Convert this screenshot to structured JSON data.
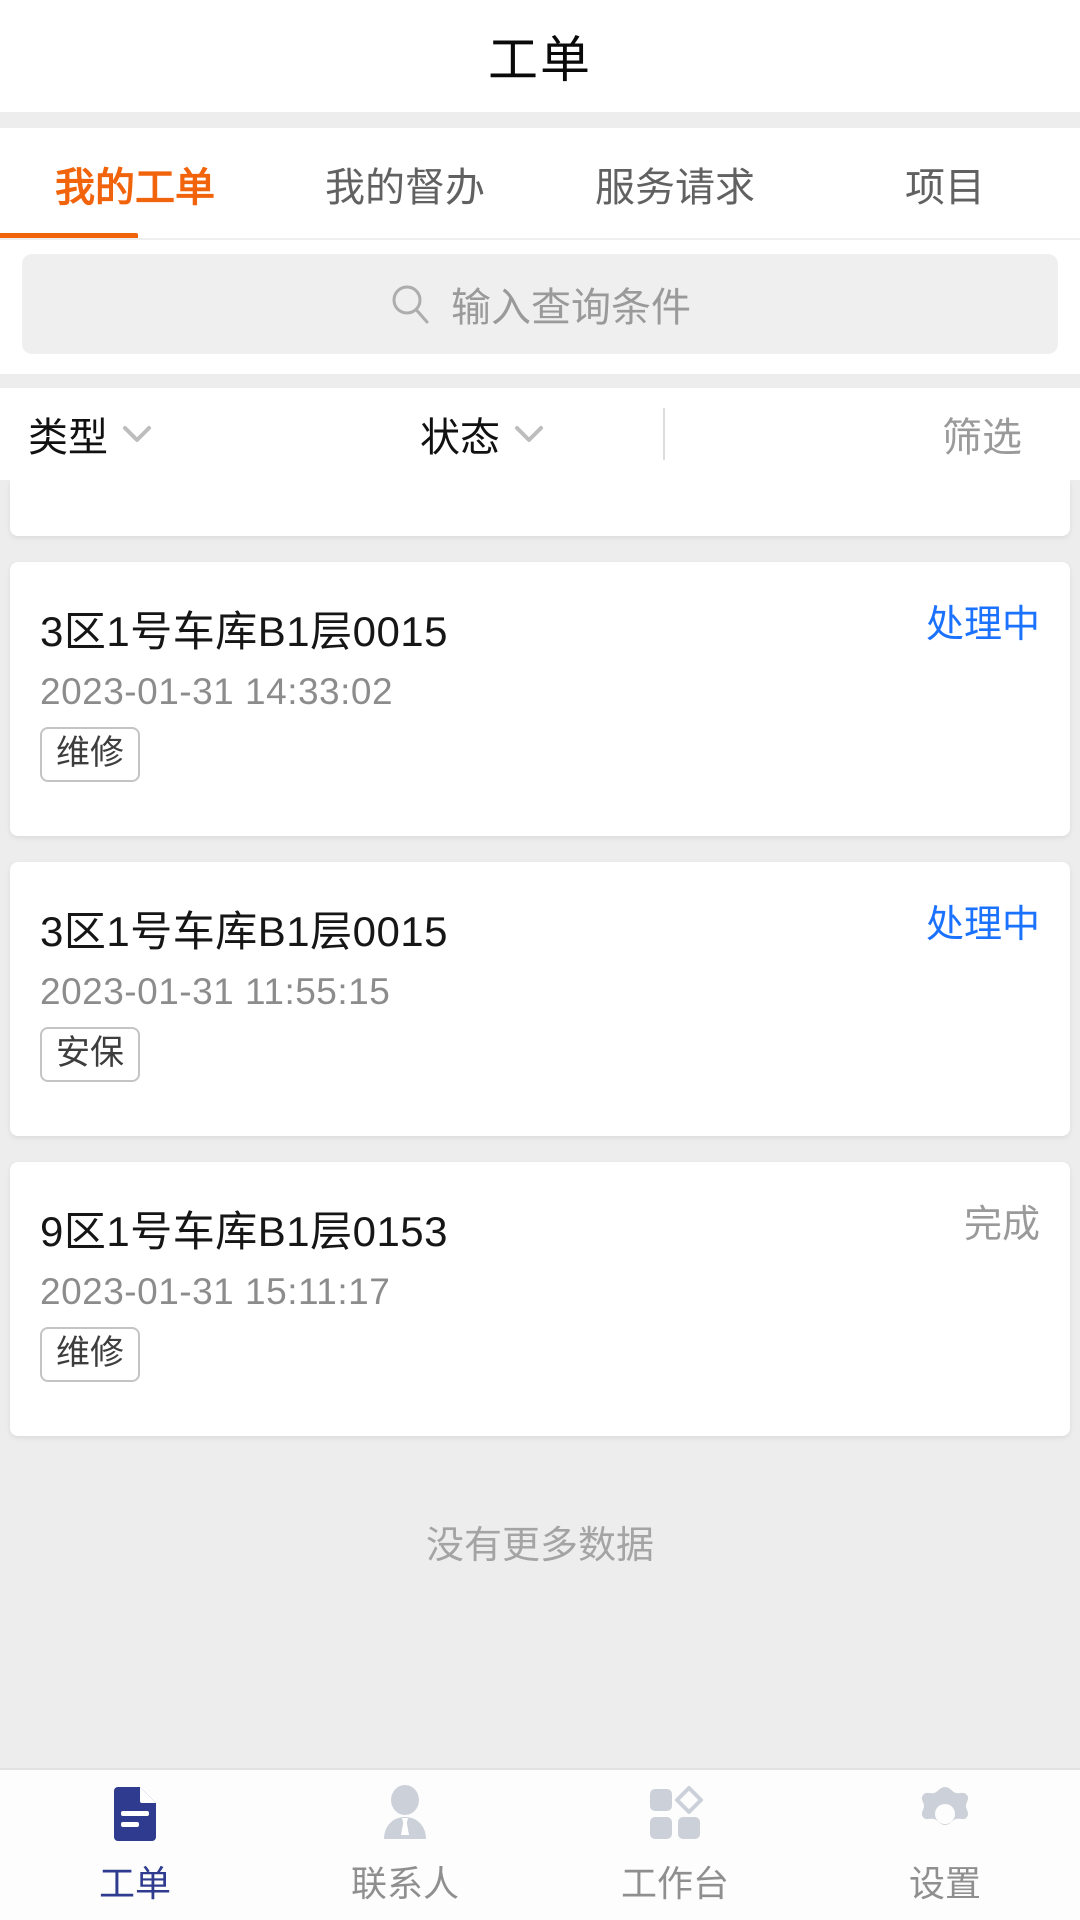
{
  "header": {
    "title": "工单"
  },
  "tabs": [
    {
      "label": "我的工单",
      "active": true
    },
    {
      "label": "我的督办",
      "active": false
    },
    {
      "label": "服务请求",
      "active": false
    },
    {
      "label": "项目",
      "active": false
    }
  ],
  "search": {
    "placeholder": "输入查询条件",
    "value": "",
    "icon": "search-icon"
  },
  "filters": {
    "type_label": "类型",
    "status_label": "状态",
    "screen_label": "筛选"
  },
  "list": {
    "cards": [
      {
        "title": "3区1号车库B1层0015",
        "time": "2023-01-31 14:33:02",
        "tag": "维修",
        "status": "处理中",
        "status_kind": "processing"
      },
      {
        "title": "3区1号车库B1层0015",
        "time": "2023-01-31 11:55:15",
        "tag": "安保",
        "status": "处理中",
        "status_kind": "processing"
      },
      {
        "title": "9区1号车库B1层0153",
        "time": "2023-01-31 15:11:17",
        "tag": "维修",
        "status": "完成",
        "status_kind": "done"
      }
    ],
    "no_more_text": "没有更多数据"
  },
  "bottom_nav": [
    {
      "label": "工单",
      "icon": "document-icon",
      "active": true
    },
    {
      "label": "联系人",
      "icon": "person-icon",
      "active": false
    },
    {
      "label": "工作台",
      "icon": "workbench-grid-icon",
      "active": false
    },
    {
      "label": "设置",
      "icon": "gear-icon",
      "active": false
    }
  ],
  "colors": {
    "accent_orange": "#f2640c",
    "status_blue": "#1a72ff",
    "nav_active_navy": "#2e3b8f",
    "page_bg": "#ededed",
    "muted_gray": "#9a9a9a"
  }
}
